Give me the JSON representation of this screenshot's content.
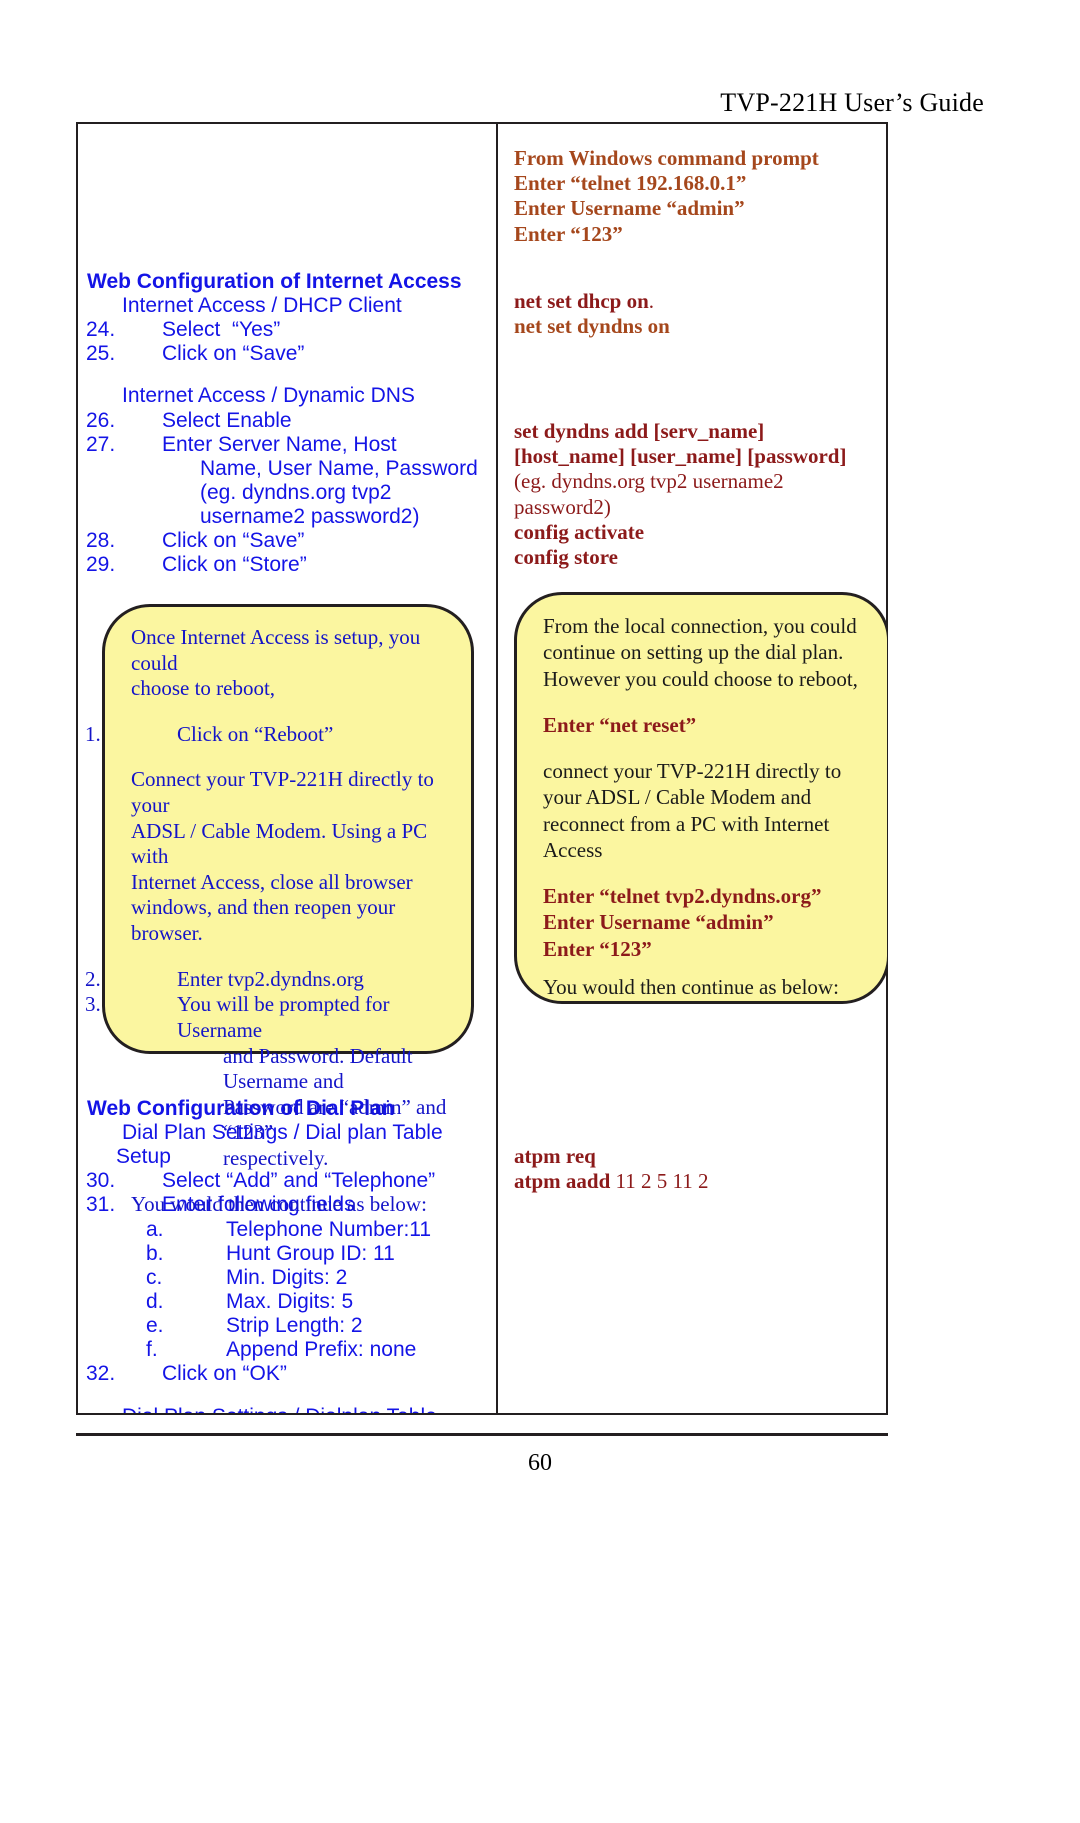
{
  "header": {
    "title": "TVP-221H User’s Guide"
  },
  "footer": {
    "page_number": "60"
  },
  "left_column": {
    "internet_section": {
      "heading": "Web Configuration of Internet Access",
      "sub1": "Internet Access / DHCP Client",
      "items1": [
        {
          "num": "24.",
          "text": "Select  “Yes”"
        },
        {
          "num": "25.",
          "text": "Click on “Save”"
        }
      ],
      "sub2": "Internet Access / Dynamic DNS",
      "items2": [
        {
          "num": "26.",
          "text": "Select Enable"
        },
        {
          "num": "27.",
          "text": "Enter Server Name, Host"
        }
      ],
      "item27_cont1": "Name, User Name, Password",
      "item27_cont2": "(eg. dyndns.org tvp2",
      "item27_cont3": "username2 password2)",
      "items3": [
        {
          "num": "28.",
          "text": "Click on “Save”"
        },
        {
          "num": "29.",
          "text": "Click on “Store”"
        }
      ]
    },
    "callout": {
      "line1": "Once Internet Access is setup, you could",
      "line2": "choose to reboot,",
      "step1_num": "1.",
      "step1_text": "Click on “Reboot”",
      "para1_l1": "Connect your TVP-221H directly to your",
      "para1_l2": "ADSL / Cable Modem. Using a PC with",
      "para1_l3": "Internet Access,  close all browser",
      "para1_l4": "windows, and then reopen your browser.",
      "step2_num": "2.",
      "step2_text": "Enter tvp2.dyndns.org",
      "step3_num": "3.",
      "step3_l1": "You will be prompted for Username",
      "step3_l2": "and Password. Default Username and",
      "step3_l3": "Password are “admin” and “123”",
      "step3_l4": "respectively.",
      "closing": "You would then continue as below:"
    },
    "dialplan_section": {
      "heading": "Web Configuration of Dial Plan",
      "sub1_l1": "Dial Plan Settings / Dial plan Table",
      "sub1_l2": "Setup",
      "items": [
        {
          "num": "30.",
          "text": "Select “Add” and “Telephone”"
        },
        {
          "num": "31.",
          "text": "Enter following fields"
        }
      ],
      "sub_items": [
        {
          "num": "a.",
          "text": "Telephone Number:11"
        },
        {
          "num": "b.",
          "text": "Hunt Group ID:  11"
        },
        {
          "num": "c.",
          "text": "Min. Digits:  2"
        },
        {
          "num": "d.",
          "text": "Max. Digits:  5"
        },
        {
          "num": "e.",
          "text": "Strip Length:  2"
        },
        {
          "num": "f.",
          "text": "Append Prefix: none"
        }
      ],
      "item32": {
        "num": "32.",
        "text": "Click on “OK”"
      },
      "sub2": "Dial Plan Settings / Dialplan Table"
    }
  },
  "right_column": {
    "telnet_block": [
      "From Windows command prompt",
      "Enter “telnet 192.168.0.1”",
      "Enter Username “admin”",
      "Enter “123”"
    ],
    "net_cmds": {
      "line1_bold": "net set dhcp on",
      "line1_tail": ".",
      "line2": "net set dyndns on"
    },
    "dyndns_cmds": {
      "line1": "set dyndns add [serv_name]",
      "line2": "[host_name] [user_name] [password]",
      "eg_l1": "(eg. dyndns.org tvp2 username2",
      "eg_l2": "password2)",
      "line3": "config activate",
      "line4": "config store"
    },
    "callout": {
      "p1_l1": "From the local connection, you could",
      "p1_l2": "continue on setting up the dial plan.",
      "p1_l3": "However you could choose to reboot,",
      "enter_net_reset": "Enter “net reset”",
      "p2_l1": "connect your TVP-221H directly to",
      "p2_l2": "your ADSL / Cable Modem and",
      "p2_l3": "reconnect from a PC with Internet",
      "p2_l4": "Access",
      "telnet_l1": "Enter “telnet tvp2.dyndns.org”",
      "telnet_l2": "Enter Username “admin”",
      "telnet_l3": "Enter “123”",
      "closing": "You would then continue as below:"
    },
    "atpm": {
      "line1": "atpm req",
      "line2_bold": "atpm aadd",
      "line2_args": " 11 2 5 11 2"
    }
  }
}
